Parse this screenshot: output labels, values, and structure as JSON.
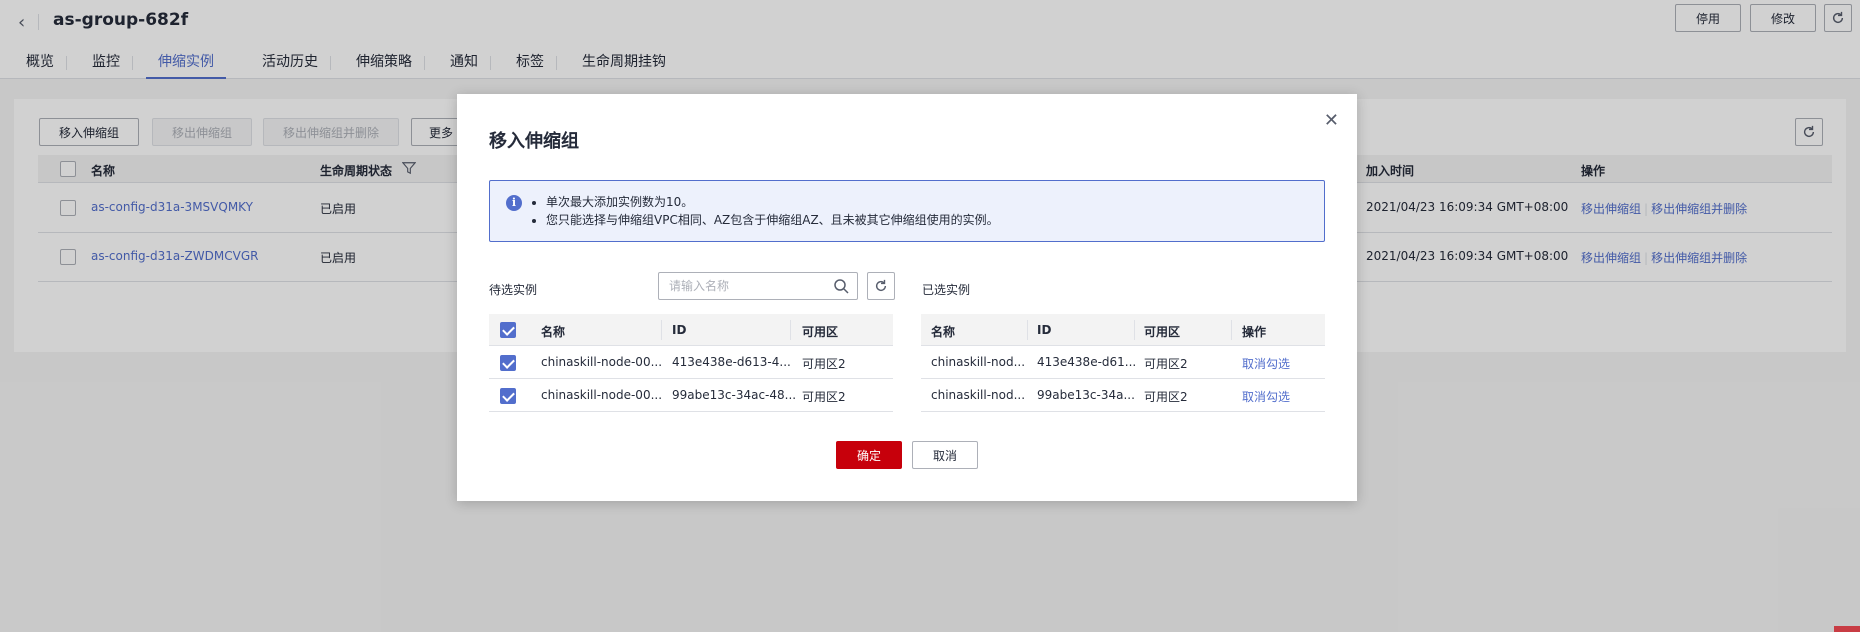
{
  "header": {
    "back_icon": "chevron-left-icon",
    "title": "as-group-682f",
    "disable_label": "停用",
    "edit_label": "修改",
    "refresh_icon": "refresh-icon"
  },
  "tabs": [
    {
      "label": "概览"
    },
    {
      "label": "监控"
    },
    {
      "label": "伸缩实例",
      "active": true
    },
    {
      "label": "活动历史"
    },
    {
      "label": "伸缩策略"
    },
    {
      "label": "通知"
    },
    {
      "label": "标签"
    },
    {
      "label": "生命周期挂钩"
    }
  ],
  "toolbar": {
    "move_in": "移入伸缩组",
    "move_out": "移出伸缩组",
    "move_out_delete": "移出伸缩组并删除",
    "more": "更多"
  },
  "grid": {
    "columns": {
      "name": "名称",
      "lifecycle": "生命周期状态",
      "join_time": "加入时间",
      "actions": "操作"
    },
    "rows": [
      {
        "name": "as-config-d31a-3MSVQMKY",
        "status": "已启用",
        "time": "2021/04/23 16:09:34 GMT+08:00",
        "action1": "移出伸缩组",
        "action2": "移出伸缩组并删除"
      },
      {
        "name": "as-config-d31a-ZWDMCVGR",
        "status": "已启用",
        "time": "2021/04/23 16:09:34 GMT+08:00",
        "action1": "移出伸缩组",
        "action2": "移出伸缩组并删除"
      }
    ]
  },
  "modal": {
    "title": "移入伸缩组",
    "info": [
      "单次最大添加实例数为10。",
      "您只能选择与伸缩组VPC相同、AZ包含于伸缩组AZ、且未被其它伸缩组使用的实例。"
    ],
    "available_label": "待选实例",
    "selected_label": "已选实例",
    "search_placeholder": "请输入名称",
    "left_table": {
      "columns": {
        "name": "名称",
        "id": "ID",
        "az": "可用区"
      },
      "rows": [
        {
          "name": "chinaskill-node-00...",
          "id": "413e438e-d613-4...",
          "az": "可用区2",
          "checked": true
        },
        {
          "name": "chinaskill-node-00...",
          "id": "99abe13c-34ac-48...",
          "az": "可用区2",
          "checked": true
        }
      ]
    },
    "right_table": {
      "columns": {
        "name": "名称",
        "id": "ID",
        "az": "可用区",
        "action": "操作"
      },
      "rows": [
        {
          "name": "chinaskill-nod...",
          "id": "413e438e-d61...",
          "az": "可用区2",
          "action": "取消勾选"
        },
        {
          "name": "chinaskill-nod...",
          "id": "99abe13c-34a...",
          "az": "可用区2",
          "action": "取消勾选"
        }
      ]
    },
    "ok_label": "确定",
    "cancel_label": "取消"
  },
  "colors": {
    "accent": "#526ecc",
    "primary_button": "#c7000b"
  }
}
